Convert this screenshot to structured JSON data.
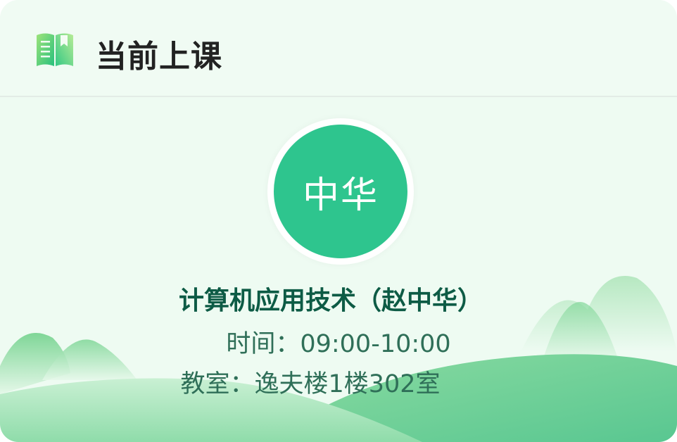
{
  "header": {
    "title": "当前上课",
    "icon": "book-icon"
  },
  "teacher_avatar": {
    "text": "中华",
    "color": "#2ec58e"
  },
  "course": {
    "name": "计算机应用技术（赵中华）",
    "time_label": "时间：",
    "time_value": "09:00-10:00",
    "room_label": "教室：",
    "room_value": "逸夫楼1楼302室"
  },
  "colors": {
    "accent": "#2ec58e",
    "course_text": "#0d5b45",
    "info_text": "#2f6f58"
  }
}
